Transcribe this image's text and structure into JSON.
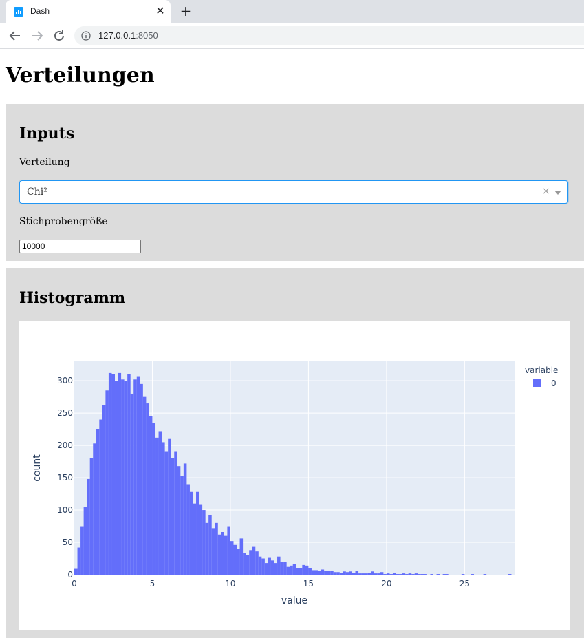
{
  "browser": {
    "tab_title": "Dash",
    "url_host": "127.0.0.1",
    "url_port": ":8050",
    "icons": [
      "dash-favicon-icon",
      "close-icon",
      "plus-icon",
      "back-arrow-icon",
      "forward-arrow-icon",
      "reload-icon",
      "info-icon"
    ]
  },
  "page": {
    "title": "Verteilungen"
  },
  "inputs_panel": {
    "heading": "Inputs",
    "distribution_label": "Verteilung",
    "distribution_value": "Chi²",
    "clear_symbol": "×",
    "sample_size_label": "Stichprobengröße",
    "sample_size_value": "10000"
  },
  "histogram_panel": {
    "heading": "Histogramm"
  },
  "chart_data": {
    "type": "bar",
    "title": "",
    "xlabel": "value",
    "ylabel": "count",
    "legend_title": "variable",
    "legend_position": "top-right",
    "bar_color": "#636efa",
    "plot_bgcolor": "#e5ecf6",
    "grid": true,
    "xlim": [
      0,
      28.2
    ],
    "ylim": [
      0,
      330
    ],
    "x_ticks": [
      "0",
      "5",
      "10",
      "15",
      "20",
      "25"
    ],
    "y_ticks": [
      "0",
      "50",
      "100",
      "150",
      "200",
      "250",
      "300"
    ],
    "bin_width": 0.2,
    "series": [
      {
        "name": "0",
        "values": [
          9,
          42,
          75,
          105,
          148,
          180,
          203,
          225,
          240,
          262,
          285,
          312,
          310,
          300,
          312,
          302,
          300,
          310,
          280,
          302,
          306,
          295,
          275,
          265,
          245,
          235,
          212,
          222,
          205,
          190,
          210,
          180,
          190,
          168,
          153,
          172,
          140,
          128,
          110,
          128,
          108,
          100,
          80,
          92,
          72,
          80,
          62,
          66,
          60,
          75,
          52,
          46,
          40,
          56,
          34,
          30,
          38,
          43,
          36,
          28,
          25,
          18,
          26,
          22,
          18,
          28,
          20,
          20,
          12,
          14,
          16,
          10,
          10,
          15,
          14,
          10,
          7,
          7,
          6,
          8,
          6,
          6,
          6,
          4,
          4,
          3,
          5,
          4,
          5,
          3,
          6,
          2,
          2,
          2,
          3,
          5,
          2,
          2,
          4,
          1,
          2,
          1,
          3,
          1,
          1,
          2,
          1,
          2,
          1,
          2,
          1,
          1,
          1,
          0,
          1,
          0,
          1,
          0,
          1,
          1,
          0,
          0,
          0,
          0,
          1,
          0,
          0,
          1,
          0,
          0,
          0,
          1,
          0,
          0,
          0,
          0,
          0,
          0,
          0,
          1,
          0
        ]
      }
    ]
  }
}
